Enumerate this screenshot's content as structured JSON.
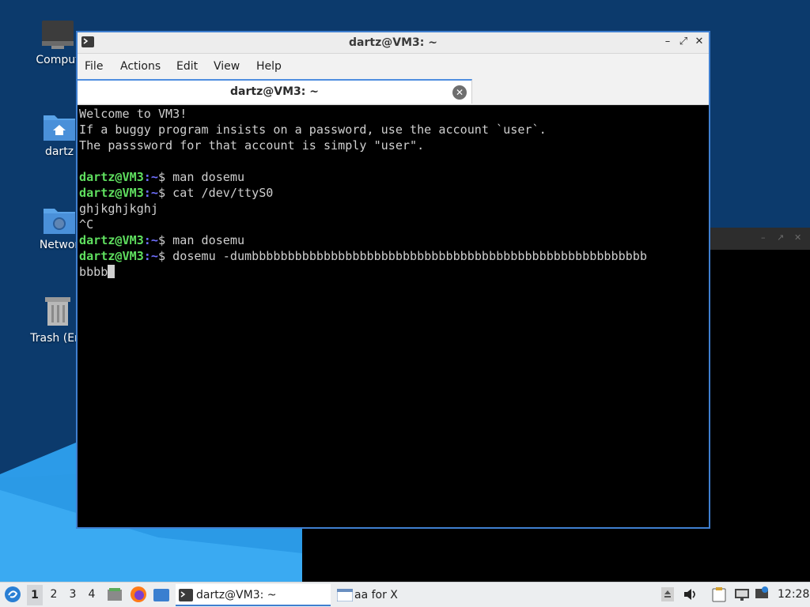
{
  "desktop": {
    "icons": [
      {
        "label": "Comput"
      },
      {
        "label": "dartz"
      },
      {
        "label": "Networ"
      },
      {
        "label": "Trash (Em"
      }
    ]
  },
  "terminal": {
    "title": "dartz@VM3: ~",
    "menu": [
      "File",
      "Actions",
      "Edit",
      "View",
      "Help"
    ],
    "tab_label": "dartz@VM3: ~",
    "prompt_user": "dartz@VM3",
    "prompt_path": ":~",
    "prompt_symbol": "$ ",
    "lines": {
      "l1": "Welcome to VM3!",
      "l2": "If a buggy program insists on a password, use the account `user`.",
      "l3": "The passsword for that account is simply \"user\".",
      "cmd1": "man dosemu",
      "cmd2": "cat /dev/ttyS0",
      "out1": "ghjkghjkghj",
      "out2": "^C",
      "cmd3": "man dosemu",
      "cmd4": "dosemu -dumbbbbbbbbbbbbbbbbbbbbbbbbbbbbbbbbbbbbbbbbbbbbbbbbbbbbbbb",
      "cmd4_wrap": "bbbb"
    }
  },
  "taskbar": {
    "workspaces": [
      "1",
      "2",
      "3",
      "4"
    ],
    "active_workspace": "1",
    "tasks": [
      {
        "label": "dartz@VM3: ~"
      },
      {
        "label": "aa for X"
      }
    ],
    "clock": "12:28"
  },
  "colors": {
    "desktop_bg": "#0c3a6c",
    "window_border": "#3f7fd0",
    "prompt_green": "#5fdf5f",
    "prompt_blue": "#6f6fff"
  }
}
